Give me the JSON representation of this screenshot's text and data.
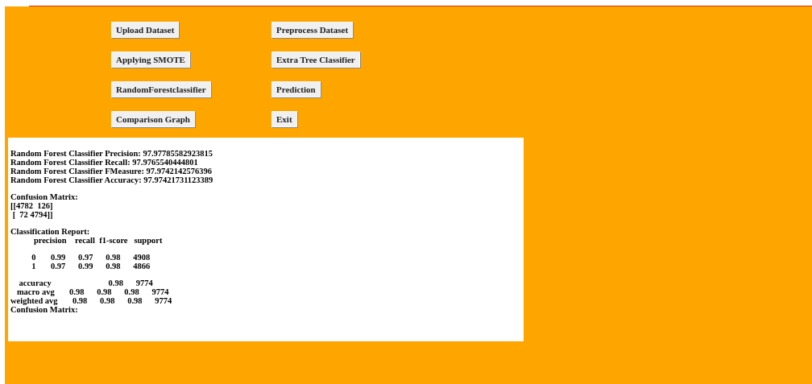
{
  "buttons": [
    {
      "label": "Upload Dataset"
    },
    {
      "label": "Preprocess Dataset"
    },
    {
      "label": "Applying SMOTE"
    },
    {
      "label": "Extra Tree Classifier"
    },
    {
      "label": "RandomForestclassifier"
    },
    {
      "label": "Prediction"
    },
    {
      "label": "Comparison Graph"
    },
    {
      "label": "Exit"
    }
  ],
  "output": {
    "blocks": [
      [
        "Random Forest Classifier Precision: 97.97785582923815",
        "Random Forest Classifier Recall: 97.9765540444801",
        "Random Forest Classifier FMeasure: 97.9742142576396",
        "Random Forest Classifier Accuracy: 97.97421731123389"
      ],
      [
        "Confusion Matrix:",
        "[[4782  126]",
        " [  72 4794]]"
      ],
      [
        "Classification Report:",
        "           precision    recall  f1-score   support"
      ],
      [
        "          0       0.99      0.97      0.98      4908",
        "          1       0.97      0.99      0.98      4866"
      ],
      [
        "    accuracy                           0.98      9774",
        "   macro avg       0.98      0.98      0.98      9774",
        "weighted avg       0.98      0.98      0.98      9774",
        "Confusion Matrix:"
      ]
    ]
  }
}
